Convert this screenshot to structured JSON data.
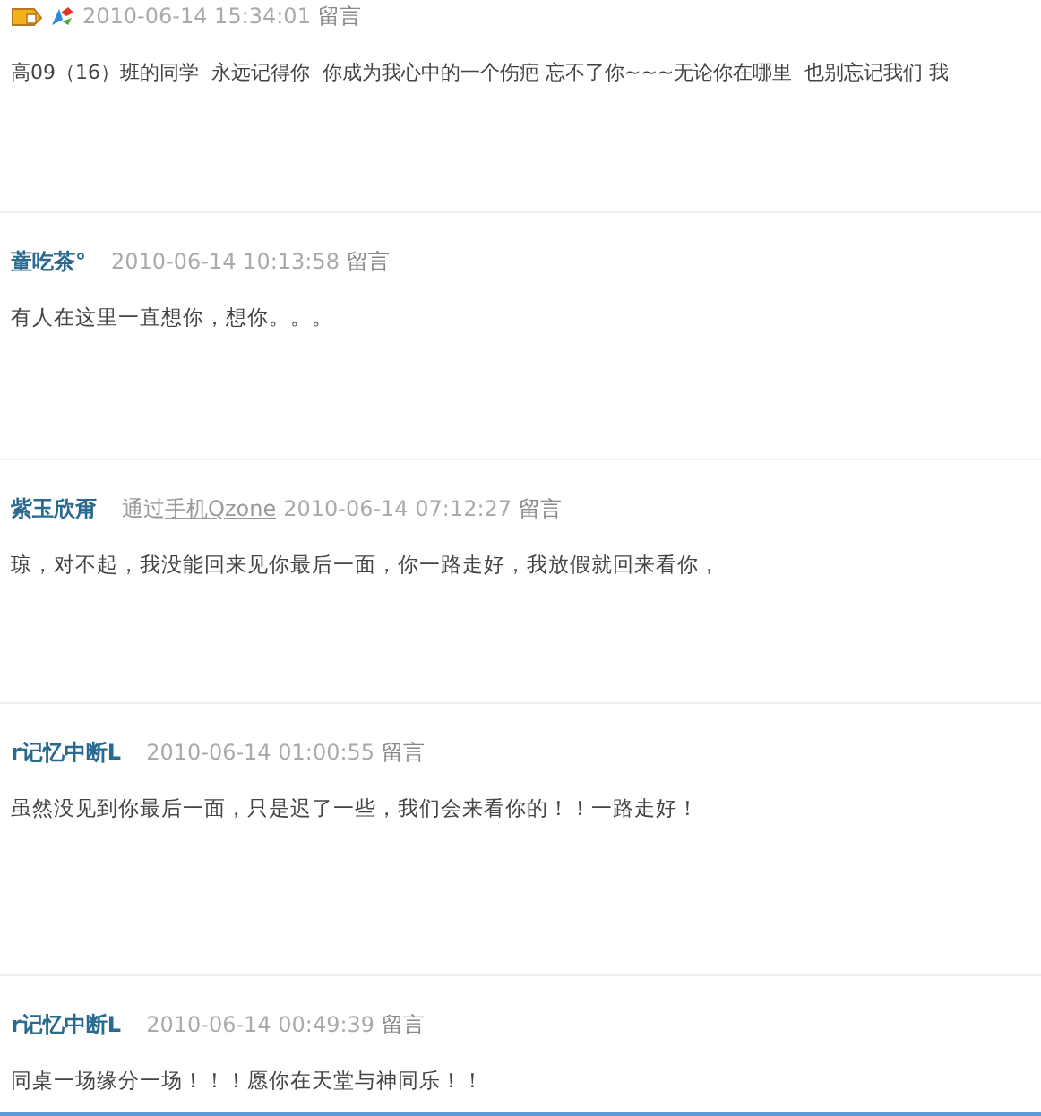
{
  "messages": [
    {
      "kind": "badged",
      "time": "2010-06-14 15:34:01",
      "action": "留言",
      "text": "高09（16）班的同学  永远记得你  你成为我心中的一个伤疤 忘不了你~~~无论你在哪里  也别忘记我们 我"
    },
    {
      "author": "蕫吃茶°",
      "time": "2010-06-14 10:13:58",
      "action": "留言",
      "text": "有人在这里一直想你，想你。。。"
    },
    {
      "author": "紫玉欣甭",
      "via": {
        "prefix": "通过",
        "link": "手机Qzone"
      },
      "time": "2010-06-14 07:12:27",
      "action": "留言",
      "text": "琼，对不起，我没能回来见你最后一面，你一路走好，我放假就回来看你，"
    },
    {
      "author": "r记忆中断L",
      "time": "2010-06-14 01:00:55",
      "action": "留言",
      "text": "虽然没见到你最后一面，只是迟了一些，我们会来看你的！！一路走好！"
    },
    {
      "author": "r记忆中断L",
      "time": "2010-06-14 00:49:39",
      "action": "留言",
      "text": "同桌一场缘分一场！！！愿你在天堂与神同乐！！"
    }
  ]
}
